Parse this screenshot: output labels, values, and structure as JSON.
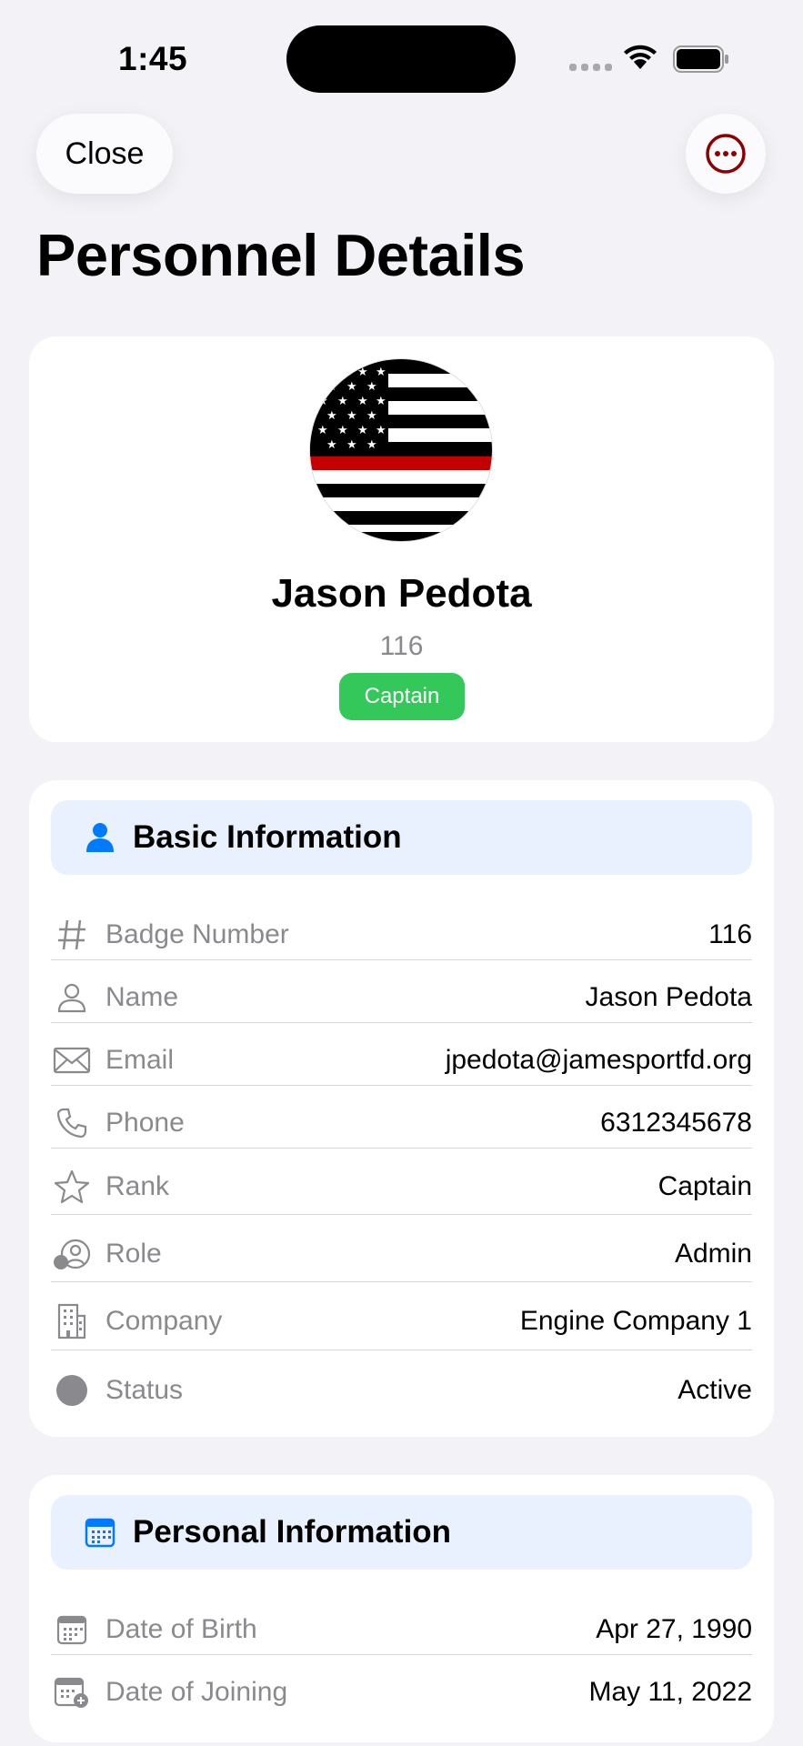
{
  "status_bar": {
    "time": "1:45"
  },
  "nav": {
    "close_label": "Close",
    "more_icon": "ellipsis-circle-icon"
  },
  "page_title": "Personnel Details",
  "profile": {
    "name": "Jason Pedota",
    "badge": "116",
    "rank": "Captain",
    "rank_color": "#34c759",
    "avatar": "thin-red-line-flag"
  },
  "basic_info": {
    "title": "Basic Information",
    "icon": "person-icon",
    "rows": [
      {
        "icon": "number-icon",
        "label": "Badge Number",
        "value": "116"
      },
      {
        "icon": "person-outline-icon",
        "label": "Name",
        "value": "Jason Pedota"
      },
      {
        "icon": "envelope-icon",
        "label": "Email",
        "value": "jpedota@jamesportfd.org"
      },
      {
        "icon": "phone-icon",
        "label": "Phone",
        "value": "6312345678"
      },
      {
        "icon": "star-icon",
        "label": "Rank",
        "value": "Captain"
      },
      {
        "icon": "person-badge-icon",
        "label": "Role",
        "value": "Admin"
      },
      {
        "icon": "building-icon",
        "label": "Company",
        "value": "Engine Company 1"
      },
      {
        "icon": "status-circle-icon",
        "label": "Status",
        "value": "Active"
      }
    ]
  },
  "personal_info": {
    "title": "Personal Information",
    "icon": "calendar-icon",
    "rows": [
      {
        "icon": "calendar-icon",
        "label": "Date of Birth",
        "value": "Apr 27, 1990"
      },
      {
        "icon": "calendar-add-icon",
        "label": "Date of Joining",
        "value": "May 11, 2022"
      }
    ]
  },
  "colors": {
    "accent": "#007aff",
    "more_icon": "#8b0000",
    "background": "#f2f2f7",
    "section_header": "#e8f1fd"
  }
}
